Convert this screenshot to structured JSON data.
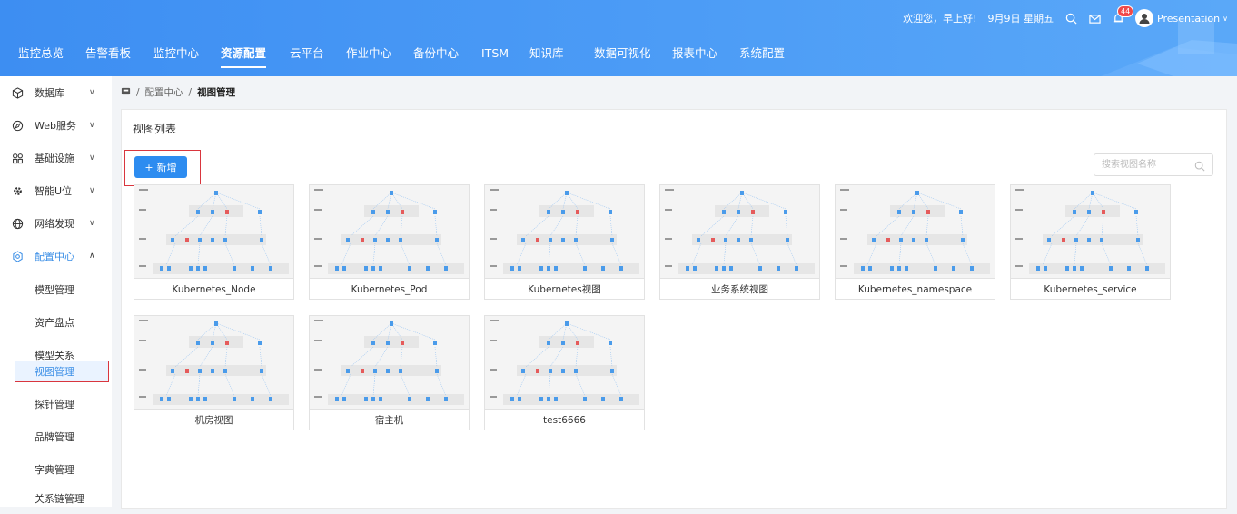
{
  "header": {
    "greeting": "欢迎您，早上好!",
    "date": "9月9日 星期五",
    "notif_count": "44",
    "user": "Presentation",
    "nav": [
      "监控总览",
      "告警看板",
      "监控中心",
      "资源配置",
      "云平台",
      "作业中心",
      "备份中心",
      "ITSM",
      "知识库",
      "数据可视化",
      "报表中心",
      "系统配置"
    ],
    "active_nav": "资源配置"
  },
  "sidebar": {
    "items": [
      {
        "label": "数据库",
        "icon": "cube-icon"
      },
      {
        "label": "Web服务",
        "icon": "compass-icon"
      },
      {
        "label": "基础设施",
        "icon": "grid-icon"
      },
      {
        "label": "智能U位",
        "icon": "gear-icon"
      },
      {
        "label": "网络发现",
        "icon": "globe-icon"
      },
      {
        "label": "配置中心",
        "icon": "settings-icon"
      }
    ],
    "sub": [
      "模型管理",
      "资产盘点",
      "模型关系",
      "视图管理",
      "探针管理",
      "品牌管理",
      "字典管理",
      "关系链管理"
    ],
    "active_sub": "视图管理"
  },
  "breadcrumb": {
    "home_icon": "home-icon",
    "level1": "配置中心",
    "current": "视图管理"
  },
  "panel": {
    "title": "视图列表",
    "add_label": "新增",
    "search_placeholder": "搜索视图名称",
    "views": [
      "Kubernetes_Node",
      "Kubernetes_Pod",
      "Kubernetes视图",
      "业务系统视图",
      "Kubernetes_namespace",
      "Kubernetes_service",
      "机房视图",
      "宿主机",
      "test6666"
    ]
  },
  "colors": {
    "accent": "#2d8cf0",
    "header": "#4695f4",
    "highlight": "#d9363e"
  }
}
